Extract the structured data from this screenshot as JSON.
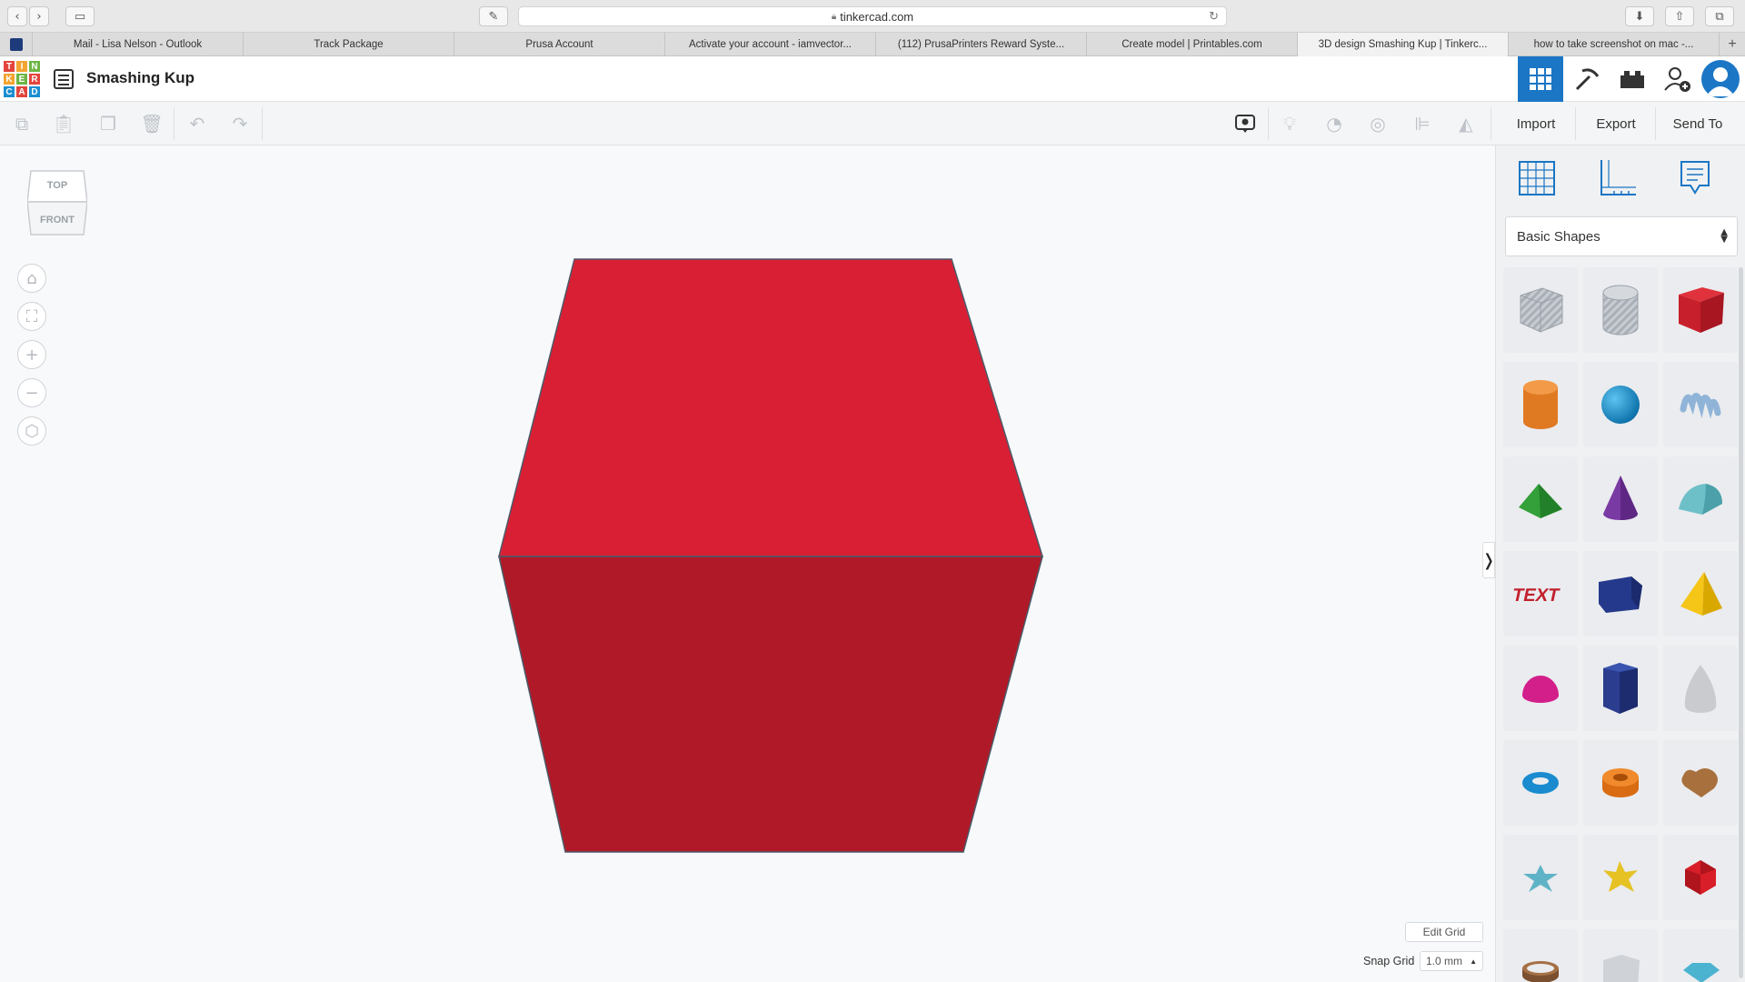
{
  "browser": {
    "url": "tinkercad.com",
    "tabs": [
      "Mail - Lisa Nelson - Outlook",
      "Track Package",
      "Prusa Account",
      "Activate your account - iamvector...",
      "(112) PrusaPrinters Reward Syste...",
      "Create model | Printables.com",
      "3D design Smashing Kup | Tinkerc...",
      "how to take screenshot on mac -..."
    ],
    "active_tab": 6
  },
  "app": {
    "logo_letters": [
      "T",
      "I",
      "N",
      "K",
      "E",
      "R",
      "C",
      "A",
      "D"
    ],
    "design_title": "Smashing Kup"
  },
  "toolbar": {
    "import_label": "Import",
    "export_label": "Export",
    "send_to_label": "Send To"
  },
  "viewcube": {
    "top_label": "TOP",
    "front_label": "FRONT"
  },
  "panel": {
    "category": "Basic Shapes",
    "shapes": [
      "box-hole",
      "cylinder-hole",
      "box",
      "cylinder",
      "sphere",
      "scribble",
      "roof",
      "cone",
      "round-roof",
      "text",
      "polygon",
      "pyramid",
      "half-sphere",
      "hexagonal-prism",
      "paraboloid",
      "torus",
      "tube",
      "heart",
      "star",
      "star-gold",
      "icosahedron",
      "ring",
      "dice-hole",
      "diamond"
    ]
  },
  "grid": {
    "edit_label": "Edit Grid",
    "snap_label": "Snap Grid",
    "snap_value": "1.0 mm"
  },
  "colors": {
    "box_top": "#d91f34",
    "box_front": "#b01a28",
    "accent": "#1b76c5"
  }
}
